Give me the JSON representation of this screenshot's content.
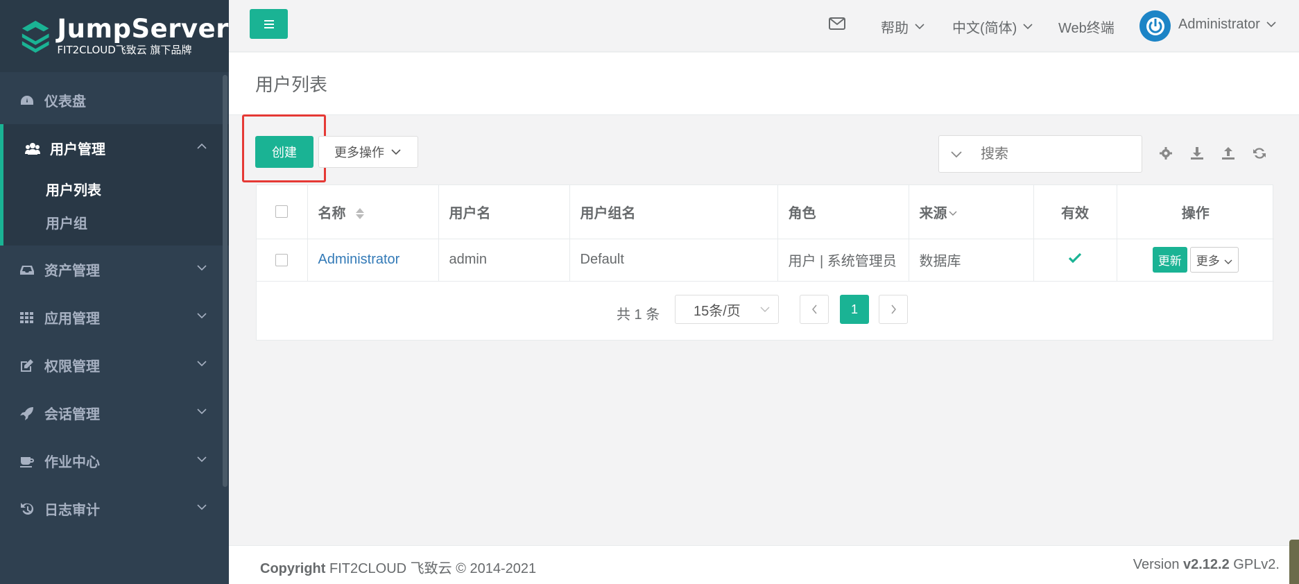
{
  "app": {
    "logo_title": "JumpServer",
    "logo_subtitle": "FIT2CLOUD飞致云 旗下品牌"
  },
  "sidebar": {
    "items": [
      {
        "label": "仪表盘",
        "icon": "dashboard-icon"
      },
      {
        "label": "用户管理",
        "icon": "users-icon",
        "active": true,
        "children": [
          {
            "label": "用户列表",
            "current": true
          },
          {
            "label": "用户组"
          }
        ]
      },
      {
        "label": "资产管理",
        "icon": "inbox-icon"
      },
      {
        "label": "应用管理",
        "icon": "grid-icon"
      },
      {
        "label": "权限管理",
        "icon": "edit-icon"
      },
      {
        "label": "会话管理",
        "icon": "rocket-icon"
      },
      {
        "label": "作业中心",
        "icon": "coffee-icon"
      },
      {
        "label": "日志审计",
        "icon": "history-icon"
      }
    ]
  },
  "topbar": {
    "help": "帮助",
    "language": "中文(简体)",
    "web_terminal": "Web终端",
    "user": "Administrator"
  },
  "page": {
    "title": "用户列表"
  },
  "toolbar": {
    "create": "创建",
    "more_actions": "更多操作",
    "search_placeholder": "搜索"
  },
  "table": {
    "headers": {
      "name": "名称",
      "username": "用户名",
      "group": "用户组名",
      "role": "角色",
      "source": "来源",
      "valid": "有效",
      "actions": "操作"
    },
    "rows": [
      {
        "name": "Administrator",
        "username": "admin",
        "group": "Default",
        "role": "用户 | 系统管理员",
        "source": "数据库",
        "valid": true,
        "update": "更新",
        "more": "更多"
      }
    ]
  },
  "pagination": {
    "total": "共 1 条",
    "page_size": "15条/页",
    "current_page": "1"
  },
  "footer": {
    "copyright_bold": "Copyright",
    "copyright_text": " FIT2CLOUD 飞致云 © 2014-2021",
    "version_prefix": "Version ",
    "version": "v2.12.2",
    "license": " GPLv2."
  },
  "colors": {
    "accent": "#1ab394",
    "sidebar": "#2f4050",
    "link": "#337ab7",
    "highlight": "#e53935"
  }
}
